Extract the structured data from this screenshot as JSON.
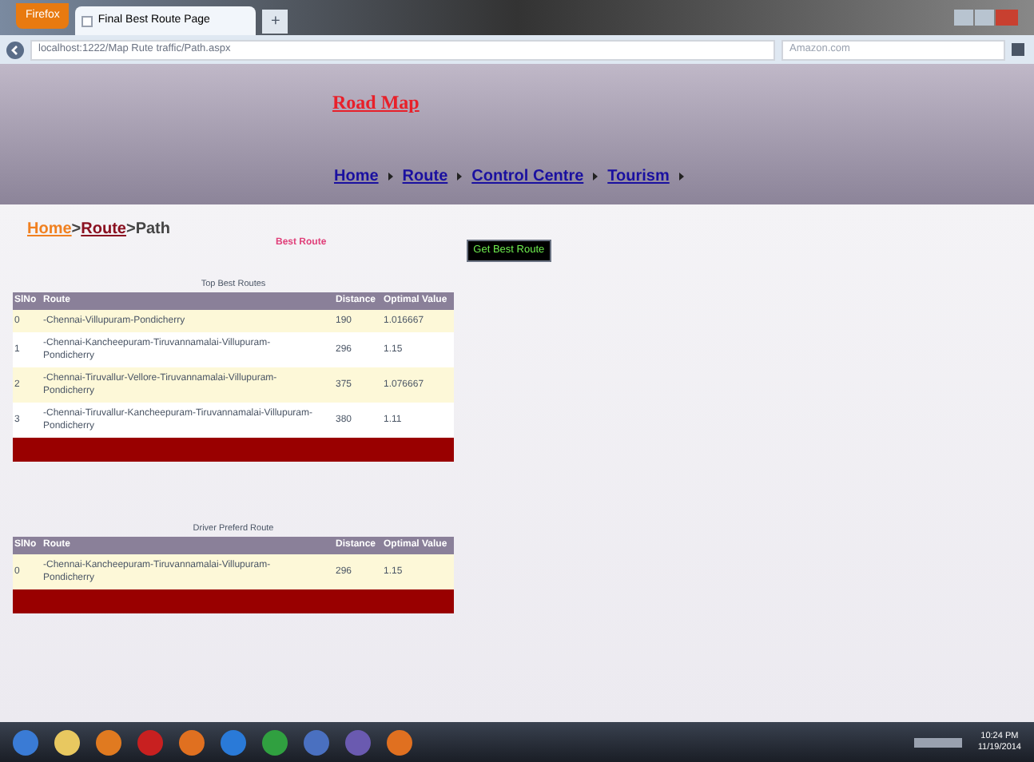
{
  "browser": {
    "menu_button": "Firefox",
    "tab_title": "Final Best Route Page",
    "new_tab": "+",
    "address": "localhost:1222/Map Rute traffic/Path.aspx",
    "search_placeholder": "Amazon.com"
  },
  "header": {
    "title": "Road Map",
    "nav": [
      "Home",
      "Route",
      "Control Centre",
      "Tourism"
    ]
  },
  "breadcrumb_separator": ">",
  "breadcrumb": [
    {
      "label": "Home",
      "kind": "link"
    },
    {
      "label": "Route",
      "kind": "link"
    },
    {
      "label": "Path",
      "kind": "current"
    }
  ],
  "heading": "Best Route",
  "button": "Get Best Route",
  "tables": [
    {
      "caption": "Top Best Routes",
      "columns": [
        "SlNo",
        "Route",
        "Distance",
        "Optimal Value"
      ],
      "rows": [
        [
          "0",
          "-Chennai-Villupuram-Pondicherry",
          "190",
          "1.016667"
        ],
        [
          "1",
          "-Chennai-Kancheepuram-Tiruvannamalai-Villupuram-Pondicherry",
          "296",
          "1.15"
        ],
        [
          "2",
          "-Chennai-Tiruvallur-Vellore-Tiruvannamalai-Villupuram-Pondicherry",
          "375",
          "1.076667"
        ],
        [
          "3",
          "-Chennai-Tiruvallur-Kancheepuram-Tiruvannamalai-Villupuram-Pondicherry",
          "380",
          "1.11"
        ]
      ]
    },
    {
      "caption": "Driver Preferd Route",
      "columns": [
        "SlNo",
        "Route",
        "Distance",
        "Optimal Value"
      ],
      "rows": [
        [
          "0",
          "-Chennai-Kancheepuram-Tiruvannamalai-Villupuram-Pondicherry",
          "296",
          "1.15"
        ]
      ]
    }
  ],
  "taskbar": {
    "time": "10:24 PM",
    "date": "11/19/2014"
  }
}
